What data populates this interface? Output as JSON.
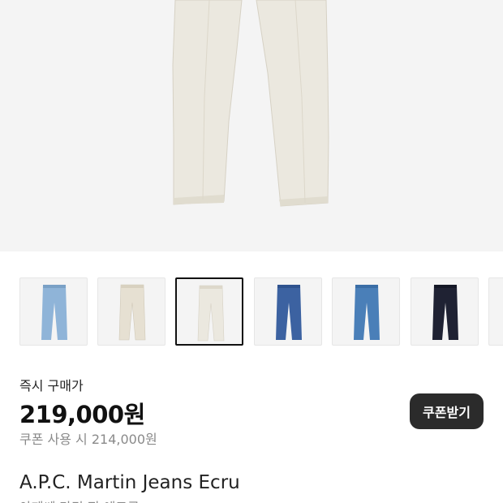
{
  "product": {
    "thumbnails": [
      {
        "name": "light-blue",
        "color": "#8fb4d8",
        "selected": false
      },
      {
        "name": "ecru",
        "color": "#e6e0d2",
        "selected": false
      },
      {
        "name": "ecru",
        "color": "#ebe8df",
        "selected": true
      },
      {
        "name": "mid-blue",
        "color": "#3c62a1",
        "selected": false
      },
      {
        "name": "washed-blue",
        "color": "#4a7fb8",
        "selected": false
      },
      {
        "name": "indigo",
        "color": "#1f2233",
        "selected": false
      },
      {
        "name": "more",
        "color": "#d9d9d9",
        "selected": false
      }
    ],
    "price_label": "즉시 구매가",
    "price": "219,000원",
    "coupon_price": "쿠폰 사용 시 214,000원",
    "coupon_button_label": "쿠폰받기",
    "title": "A.P.C. Martin Jeans Ecru",
    "subtitle": "아페쎄 마틴 진 에크루"
  },
  "colors": {
    "hero_bg": "#f4f4f4",
    "pants": "#ebe8df",
    "button_bg": "#2b2b2b",
    "muted_text": "#8a8a8a"
  }
}
